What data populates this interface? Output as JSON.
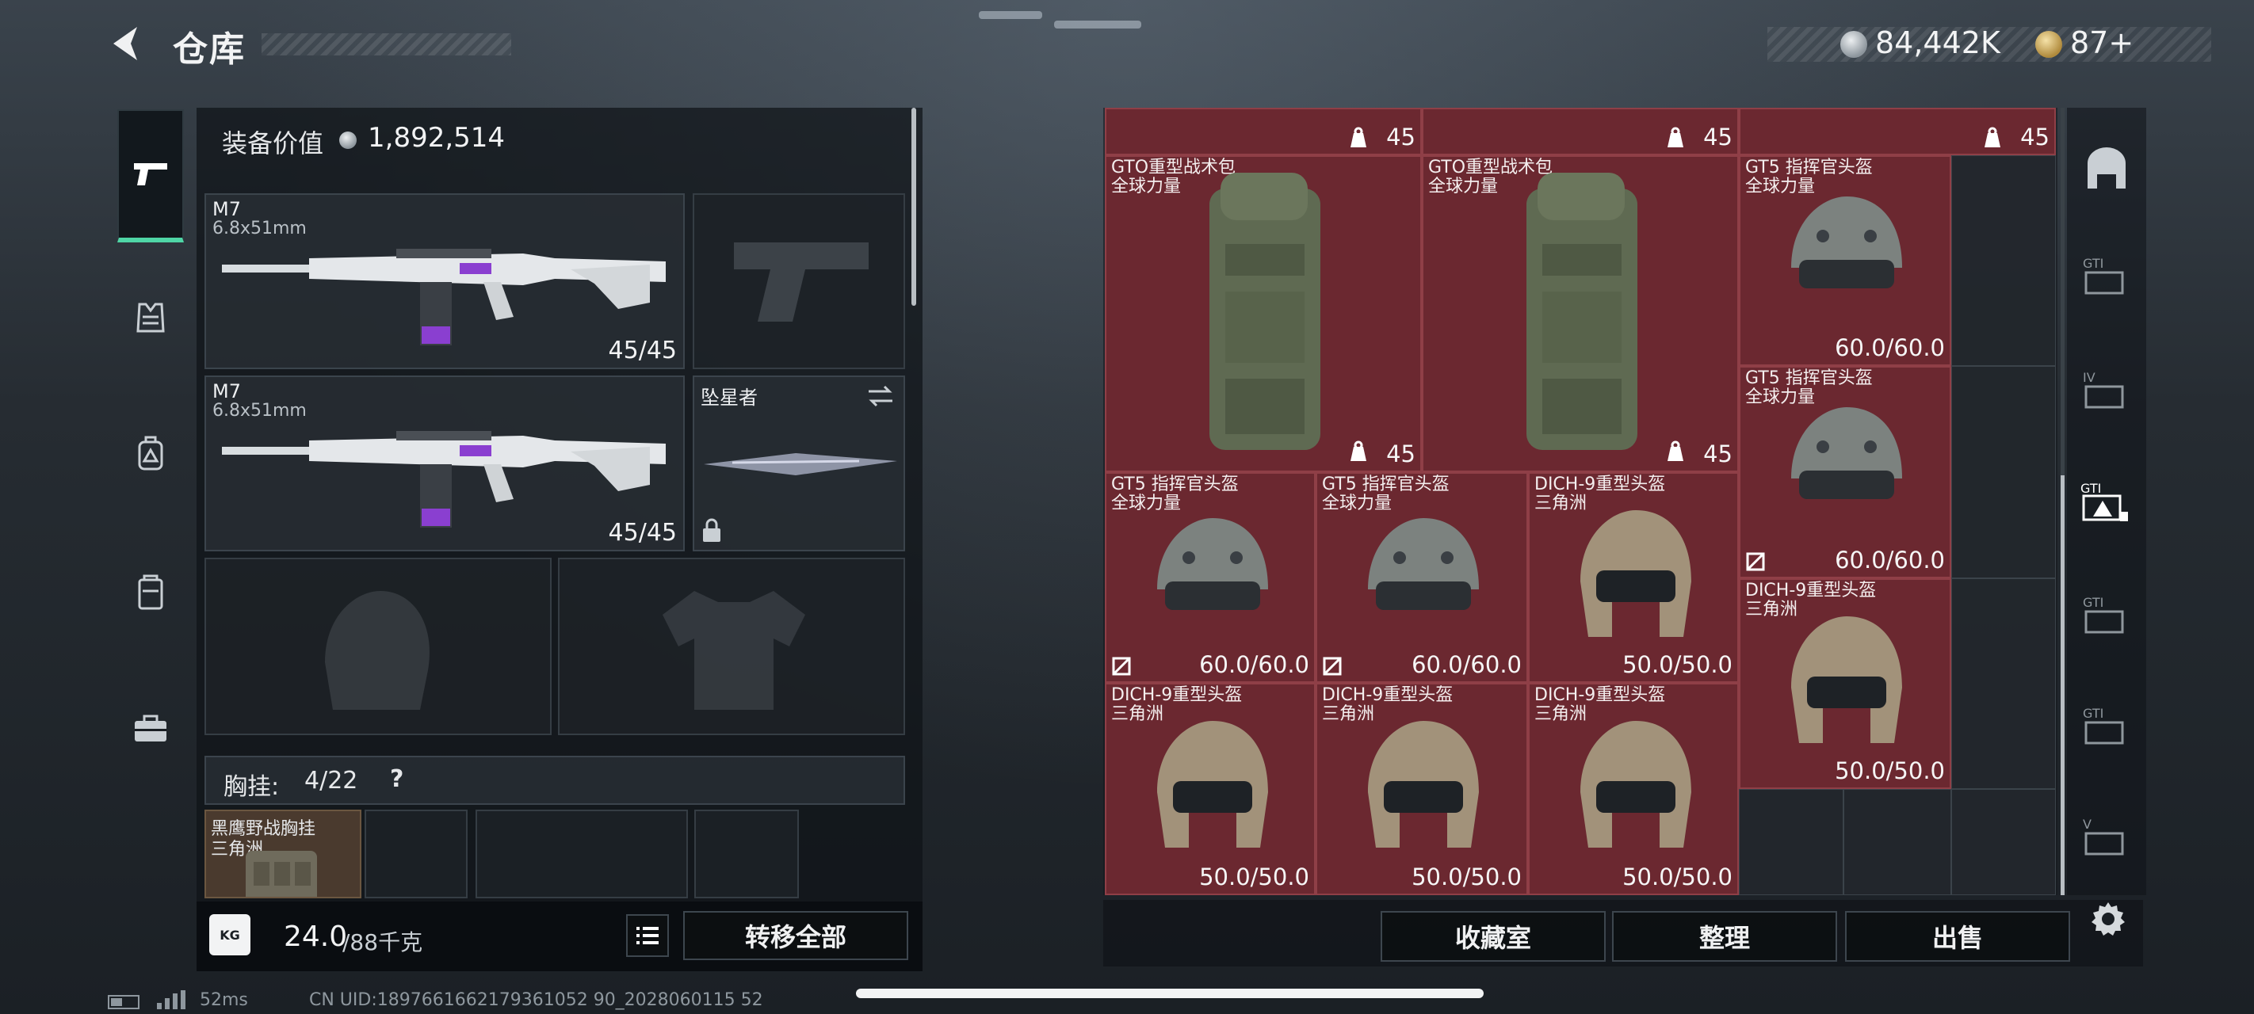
{
  "header": {
    "title": "仓库",
    "currency_primary": "84,442K",
    "currency_secondary": "87+"
  },
  "left_panel": {
    "equipment_value_label": "装备价值",
    "equipment_value": "1,892,514",
    "primary_weapon_1": {
      "name": "M7",
      "caliber": "6.8x51mm",
      "ammo": "45/45"
    },
    "primary_weapon_2": {
      "name": "M7",
      "caliber": "6.8x51mm",
      "ammo": "45/45"
    },
    "melee": {
      "name": "坠星者"
    },
    "chest_rig_label": "胸挂:",
    "chest_rig_capacity": "4/22",
    "chest_rig_help": "?",
    "chest_rig_item": {
      "name": "黑鹰野战胸挂",
      "sub": "三角洲"
    },
    "weight_value": "24.0",
    "weight_max": "/88千克",
    "transfer_all_label": "转移全部",
    "weight_icon_label": "KG"
  },
  "stash": {
    "top_row_counts": [
      "45",
      "45",
      "45"
    ],
    "items": [
      {
        "name": "GTO重型战术包",
        "sub": "全球力量",
        "value": "45"
      },
      {
        "name": "GTO重型战术包",
        "sub": "全球力量",
        "value": "45"
      },
      {
        "name": "GT5 指挥官头盔",
        "sub": "全球力量",
        "value": "60.0/60.0"
      },
      {
        "name": "GT5 指挥官头盔",
        "sub": "全球力量",
        "value": "60.0/60.0"
      },
      {
        "name": "GT5 指挥官头盔",
        "sub": "全球力量",
        "value": "60.0/60.0"
      },
      {
        "name": "GT5 指挥官头盔",
        "sub": "全球力量",
        "value": "60.0/60.0"
      },
      {
        "name": "DICH-9重型头盔",
        "sub": "三角洲",
        "value": "50.0/50.0"
      },
      {
        "name": "DICH-9重型头盔",
        "sub": "三角洲",
        "value": "50.0/50.0"
      },
      {
        "name": "DICH-9重型头盔",
        "sub": "三角洲",
        "value": "50.0/50.0"
      },
      {
        "name": "DICH-9重型头盔",
        "sub": "三角洲",
        "value": "50.0/50.0"
      },
      {
        "name": "DICH-9重型头盔",
        "sub": "三角洲",
        "value": "50.0/50.0"
      }
    ]
  },
  "bottom_actions": {
    "collection_label": "收藏室",
    "sort_label": "整理",
    "sell_label": "出售"
  },
  "status_bar": {
    "ping": "52ms",
    "uid": "CN UID:1897661662179361052 90_2028060115 52"
  },
  "colors": {
    "accent_green": "#4fd6a6",
    "item_red": "#6b2830",
    "panel_dark": "#12181d"
  }
}
